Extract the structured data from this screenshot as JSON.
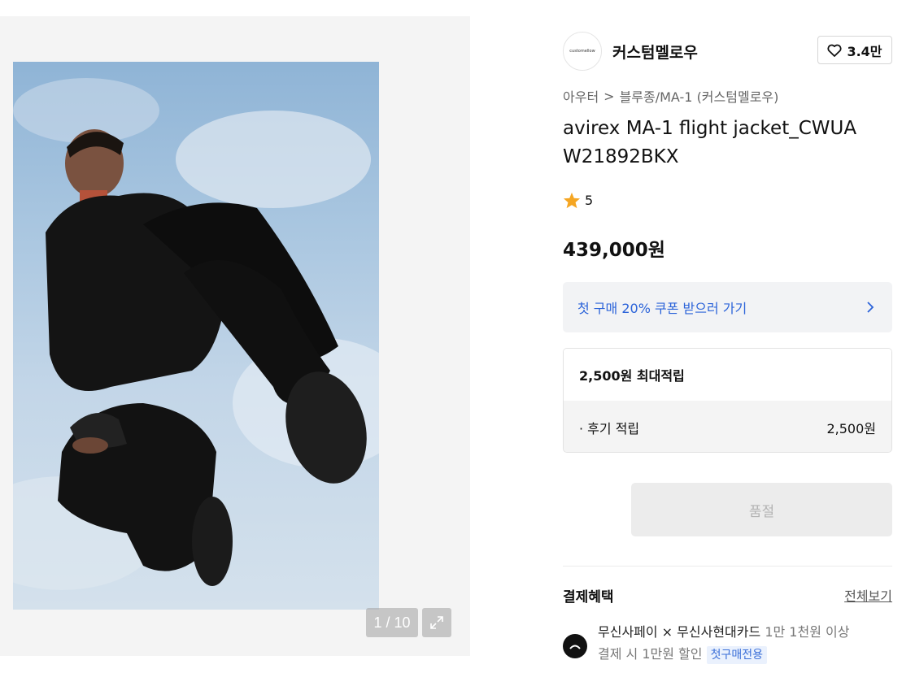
{
  "gallery": {
    "counter": "1 / 10"
  },
  "brand": {
    "logo_text": "customellow",
    "name": "커스텀멜로우",
    "likes": "3.4만"
  },
  "breadcrumb": {
    "category": "아우터",
    "separator": ">",
    "subcategory": "블루종/MA-1 (커스텀멜로우)"
  },
  "product": {
    "title": "avirex MA-1 flight jacket_CWUA W21892BKX",
    "rating": "5",
    "price": "439,000원"
  },
  "coupon": {
    "label": "첫 구매 20% 쿠폰 받으러 가기"
  },
  "points": {
    "max_label": "2,500원 최대적립",
    "review_label": "· 후기 적립",
    "review_value": "2,500원"
  },
  "purchase": {
    "soldout_label": "품절"
  },
  "benefits": {
    "title": "결제혜택",
    "view_all": "전체보기",
    "item_main": "무신사페이 × 무신사현대카드",
    "item_condition": "1만 1천원 이상",
    "item_discount": "결제 시 1만원 할인",
    "item_tag": "첫구매전용"
  },
  "colors": {
    "accent_blue": "#2b63d9",
    "star": "#f5a623",
    "soldout_bg": "#ececec"
  }
}
